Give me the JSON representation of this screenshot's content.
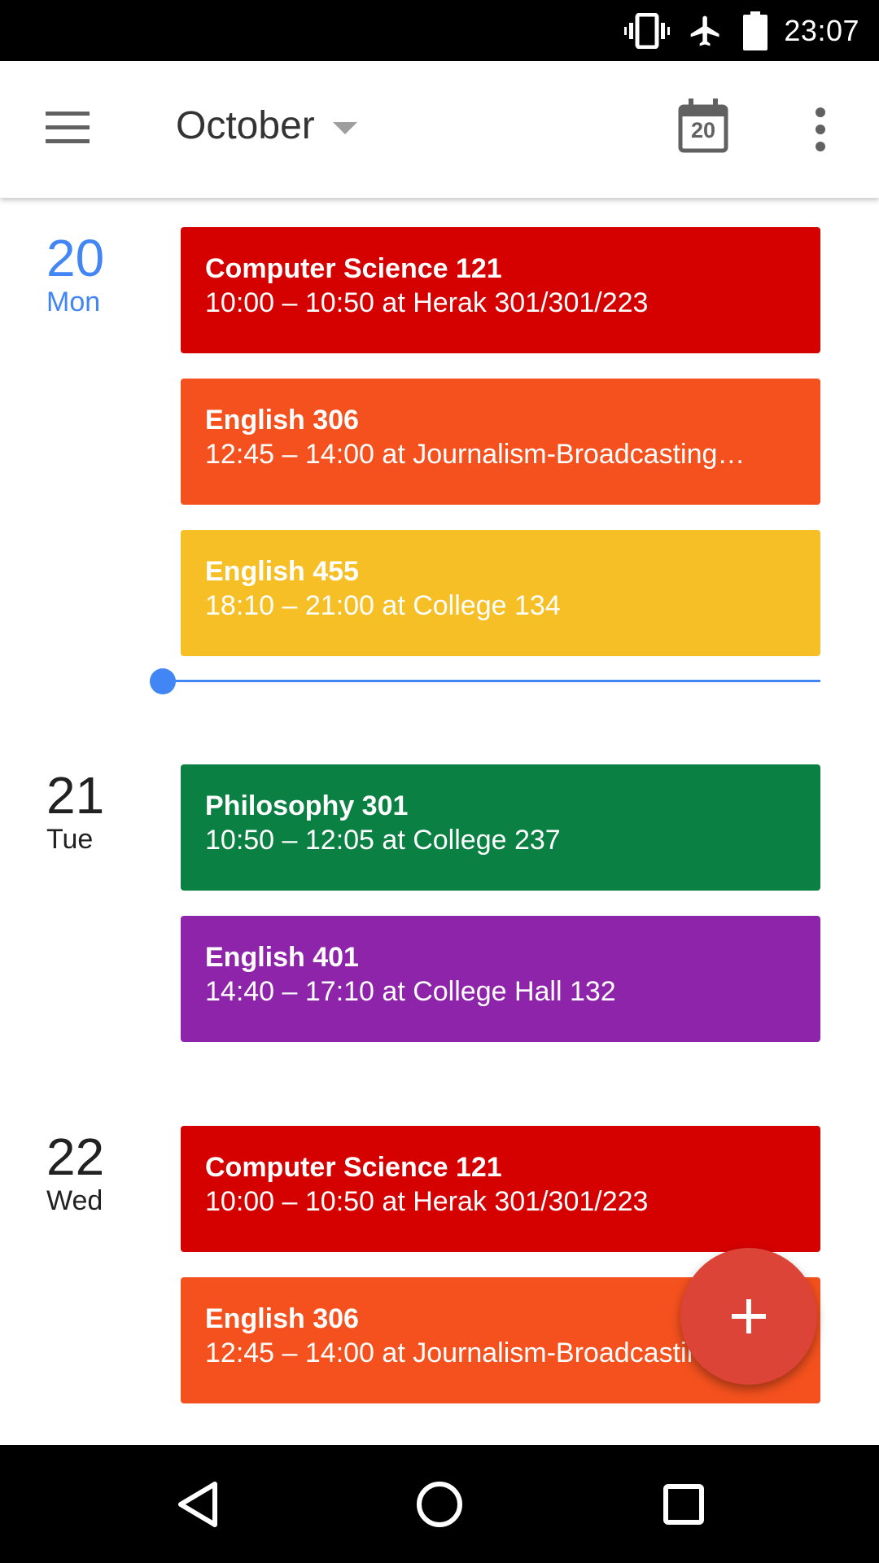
{
  "status_bar": {
    "time": "23:07",
    "icons": [
      "vibrate-icon",
      "airplane-mode-icon",
      "battery-icon"
    ]
  },
  "app_bar": {
    "month": "October",
    "today_day": "20",
    "icons": [
      "menu-icon",
      "dropdown-caret-icon",
      "calendar-today-icon",
      "more-vert-icon"
    ]
  },
  "days": [
    {
      "number": "20",
      "name": "Mon",
      "is_today": true,
      "events": [
        {
          "title": "Computer Science 121",
          "detail": "10:00 – 10:50 at Herak 301/301/223",
          "color": "#d50000"
        },
        {
          "title": "English 306",
          "detail": "12:45 – 14:00 at Journalism-Broadcasting…",
          "color": "#f4511e"
        },
        {
          "title": "English 455",
          "detail": "18:10 – 21:00 at College 134",
          "color": "#f6bf26"
        }
      ]
    },
    {
      "number": "21",
      "name": "Tue",
      "is_today": false,
      "events": [
        {
          "title": "Philosophy 301",
          "detail": "10:50 – 12:05 at College 237",
          "color": "#0b8043"
        },
        {
          "title": "English 401",
          "detail": "14:40 – 17:10 at College Hall 132",
          "color": "#8e24aa"
        }
      ]
    },
    {
      "number": "22",
      "name": "Wed",
      "is_today": false,
      "events": [
        {
          "title": "Computer Science 121",
          "detail": "10:00 – 10:50 at Herak 301/301/223",
          "color": "#d50000"
        },
        {
          "title": "English 306",
          "detail": "12:45 – 14:00 at Journalism-Broadcasting…",
          "color": "#f4511e"
        }
      ]
    }
  ],
  "fab": {
    "icon": "add-icon",
    "color": "#db4437"
  },
  "accent_color": "#4285f4",
  "nav_bar": {
    "icons": [
      "back-icon",
      "home-icon",
      "recents-icon"
    ]
  }
}
